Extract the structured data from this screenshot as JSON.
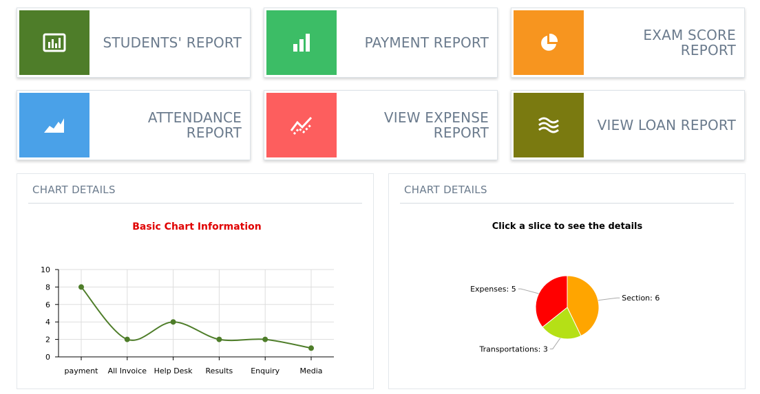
{
  "tiles": [
    {
      "label": "STUDENTS' REPORT",
      "color": "#4e7d29",
      "icon": "bar-chart-box-icon"
    },
    {
      "label": "PAYMENT REPORT",
      "color": "#3cbd66",
      "icon": "bar-chart-icon"
    },
    {
      "label": "EXAM SCORE REPORT",
      "color": "#f7951f",
      "icon": "pie-chart-icon"
    },
    {
      "label": "ATTENDANCE REPORT",
      "color": "#4aa1e8",
      "icon": "area-chart-icon"
    },
    {
      "label": "VIEW EXPENSE REPORT",
      "color": "#fd5e5e",
      "icon": "trend-line-icon"
    },
    {
      "label": "VIEW LOAN REPORT",
      "color": "#7a7a10",
      "icon": "waves-icon"
    }
  ],
  "panels": {
    "left": {
      "title": "CHART DETAILS"
    },
    "right": {
      "title": "CHART DETAILS"
    }
  },
  "chart_data": [
    {
      "type": "line",
      "title": "Basic Chart Information",
      "title_color": "#e00000",
      "categories": [
        "payment",
        "All Invoice",
        "Help Desk",
        "Results",
        "Enquiry",
        "Media"
      ],
      "series": [
        {
          "values": [
            8,
            2,
            4,
            2,
            2,
            1
          ],
          "color": "#4e7d29"
        }
      ],
      "ylim": [
        0,
        10
      ],
      "yticks": [
        0,
        2,
        4,
        6,
        8,
        10
      ],
      "grid": true
    },
    {
      "type": "pie",
      "title": "Click a slice to see the details",
      "slices": [
        {
          "label": "Section",
          "value": 6,
          "color": "#ffa500"
        },
        {
          "label": "Transportations",
          "value": 3,
          "color": "#b5e016"
        },
        {
          "label": "Expenses",
          "value": 5,
          "color": "#ff0000"
        }
      ]
    }
  ]
}
